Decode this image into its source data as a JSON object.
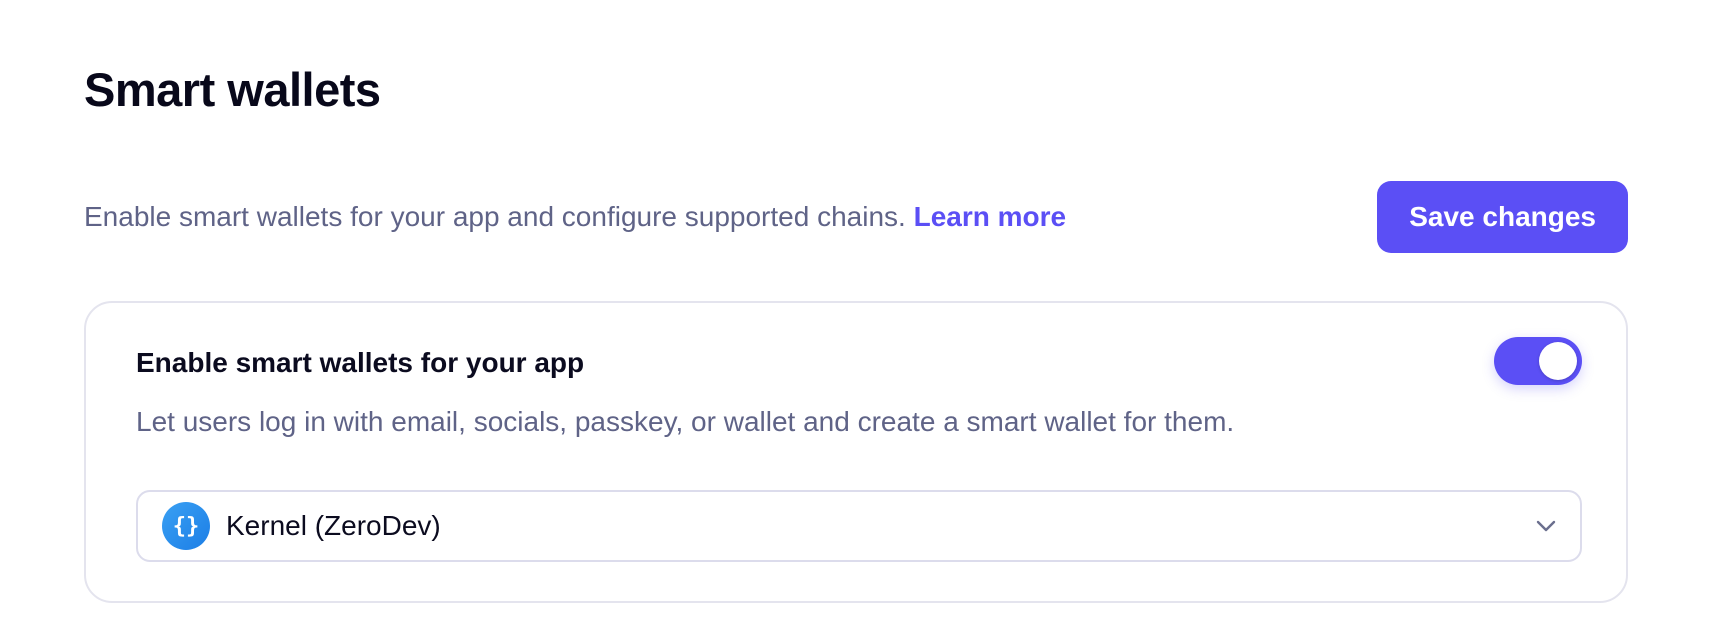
{
  "page": {
    "title": "Smart wallets",
    "description": "Enable smart wallets for your app and configure supported chains. ",
    "learn_more_label": "Learn more",
    "save_label": "Save changes"
  },
  "card": {
    "title": "Enable smart wallets for your app",
    "subtitle": "Let users log in with email, socials, passkey, or wallet and create a smart wallet for them.",
    "toggle_enabled": true,
    "provider": {
      "selected": "Kernel (ZeroDev)",
      "icon": "kernel-zerodev-logo-icon",
      "icon_glyph": "{}"
    }
  },
  "colors": {
    "accent": "#5b4ff5",
    "muted_text": "#5f6387",
    "border": "#e4e4ee"
  }
}
